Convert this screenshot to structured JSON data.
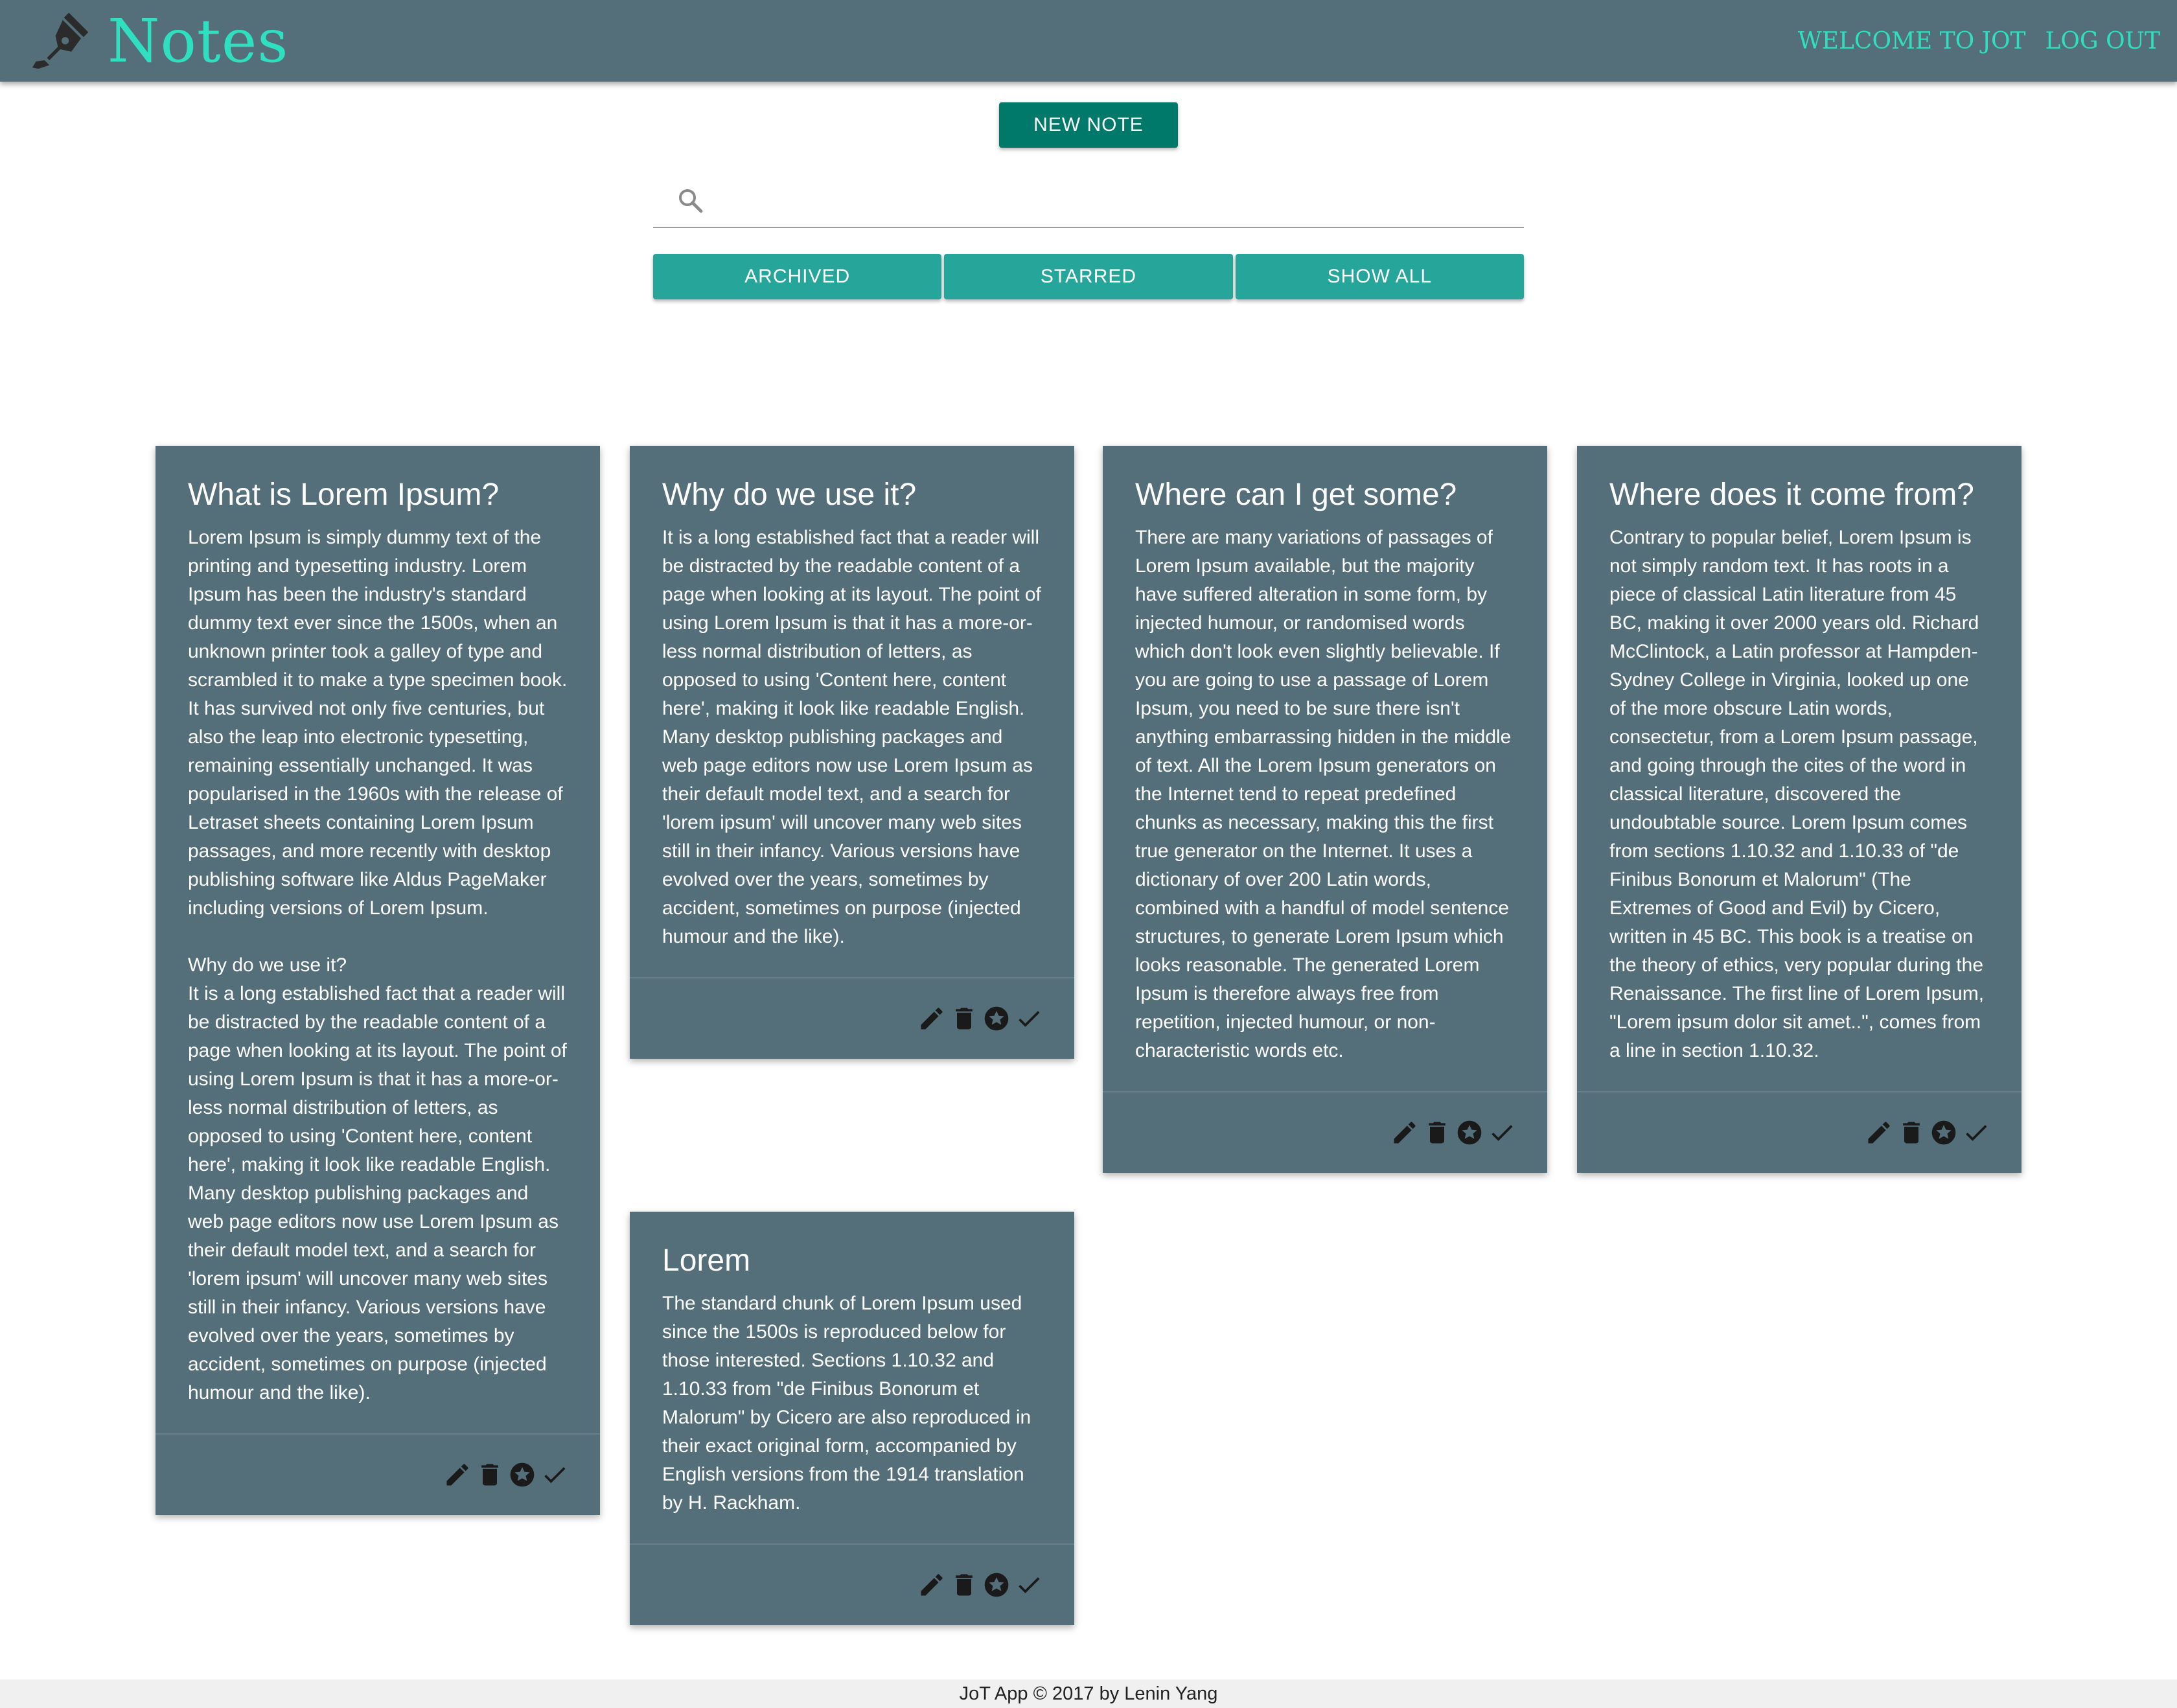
{
  "header": {
    "brand": "Notes",
    "nav": [
      "WELCOME TO JOT",
      "LOG OUT"
    ]
  },
  "toolbar": {
    "new_note_label": "NEW NOTE"
  },
  "search": {
    "value": "",
    "placeholder": ""
  },
  "filters": [
    "ARCHIVED",
    "STARRED",
    "SHOW ALL"
  ],
  "notes": [
    {
      "title": "What is Lorem Ipsum?",
      "body": "Lorem Ipsum is simply dummy text of the printing and typesetting industry. Lorem Ipsum has been the industry's standard dummy text ever since the 1500s, when an unknown printer took a galley of type and scrambled it to make a type specimen book. It has survived not only five centuries, but also the leap into electronic typesetting, remaining essentially unchanged. It was popularised in the 1960s with the release of Letraset sheets containing Lorem Ipsum passages, and more recently with desktop publishing software like Aldus PageMaker including versions of Lorem Ipsum.\n\nWhy do we use it?\nIt is a long established fact that a reader will be distracted by the readable content of a page when looking at its layout. The point of using Lorem Ipsum is that it has a more-or-less normal distribution of letters, as opposed to using 'Content here, content here', making it look like readable English. Many desktop publishing packages and web page editors now use Lorem Ipsum as their default model text, and a search for 'lorem ipsum' will uncover many web sites still in their infancy. Various versions have evolved over the years, sometimes by accident, sometimes on purpose (injected humour and the like)."
    },
    {
      "title": "Why do we use it?",
      "body": "It is a long established fact that a reader will be distracted by the readable content of a page when looking at its layout. The point of using Lorem Ipsum is that it has a more-or-less normal distribution of letters, as opposed to using 'Content here, content here', making it look like readable English. Many desktop publishing packages and web page editors now use Lorem Ipsum as their default model text, and a search for 'lorem ipsum' will uncover many web sites still in their infancy. Various versions have evolved over the years, sometimes by accident, sometimes on purpose (injected humour and the like)."
    },
    {
      "title": "Where can I get some?",
      "body": "There are many variations of passages of Lorem Ipsum available, but the majority have suffered alteration in some form, by injected humour, or randomised words which don't look even slightly believable. If you are going to use a passage of Lorem Ipsum, you need to be sure there isn't anything embarrassing hidden in the middle of text. All the Lorem Ipsum generators on the Internet tend to repeat predefined chunks as necessary, making this the first true generator on the Internet. It uses a dictionary of over 200 Latin words, combined with a handful of model sentence structures, to generate Lorem Ipsum which looks reasonable. The generated Lorem Ipsum is therefore always free from repetition, injected humour, or non-characteristic words etc."
    },
    {
      "title": "Where does it come from?",
      "body": "Contrary to popular belief, Lorem Ipsum is not simply random text. It has roots in a piece of classical Latin literature from 45 BC, making it over 2000 years old. Richard McClintock, a Latin professor at Hampden-Sydney College in Virginia, looked up one of the more obscure Latin words, consectetur, from a Lorem Ipsum passage, and going through the cites of the word in classical literature, discovered the undoubtable source. Lorem Ipsum comes from sections 1.10.32 and 1.10.33 of \"de Finibus Bonorum et Malorum\" (The Extremes of Good and Evil) by Cicero, written in 45 BC. This book is a treatise on the theory of ethics, very popular during the Renaissance. The first line of Lorem Ipsum, \"Lorem ipsum dolor sit amet..\", comes from a line in section 1.10.32."
    },
    {
      "title": "Lorem",
      "body": "The standard chunk of Lorem Ipsum used since the 1500s is reproduced below for those interested. Sections 1.10.32 and 1.10.33 from \"de Finibus Bonorum et Malorum\" by Cicero are also reproduced in their exact original form, accompanied by English versions from the 1914 translation by H. Rackham."
    }
  ],
  "note_actions": [
    "pencil-icon",
    "trash-icon",
    "star-circle-icon",
    "check-icon"
  ],
  "footer": {
    "text": "JoT App © 2017 by Lenin Yang"
  },
  "colors": {
    "header": "#546e7a",
    "brand_accent": "#2fe0c0",
    "new_note_button": "#00796b",
    "filter_button": "#26a69a",
    "card": "#546e7a"
  }
}
